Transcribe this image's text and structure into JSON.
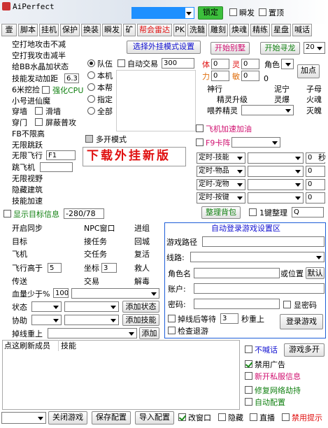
{
  "app": {
    "title": "AiPerfect"
  },
  "header": {
    "dropdown_value": "",
    "lock_button": "锁定",
    "minimize_label": "瞬发",
    "topmost_label": "置顶"
  },
  "tabs": [
    "壹",
    "脚本",
    "挂机",
    "保护",
    "换装",
    "瞬发",
    "矿",
    "帮会雷达",
    "PK",
    "洗髓",
    "雕刻",
    "焕魂",
    "精练",
    "星盘",
    "喊话"
  ],
  "left_features": {
    "items": [
      "空打地攻击不减",
      "空打我攻击减半",
      "给BB水晶加状态",
      "技能发动加距",
      "6米挖捡",
      "小号进仙魔",
      "穿墙",
      "穿门",
      "FB不限高",
      "无限跳跃",
      "无限飞行",
      "跳飞机",
      "无限视野",
      "隐藏建筑",
      "技能加速"
    ],
    "skill_dist_value": "6.3",
    "enhance_cpu": "强化CPU",
    "slide_wall": "滑墙",
    "block_normal_attack": "屏蔽普攻",
    "fly_value": "F1",
    "jump_value": "",
    "show_target_info": "显示目标信息",
    "target_info_value": "-280/78"
  },
  "group_options": {
    "radios": [
      "队伍",
      "本机",
      "本帮",
      "指定",
      "全部"
    ],
    "auto_trade": "自动交易",
    "auto_trade_value": "300",
    "multi_open": "多开模式"
  },
  "top_buttons": {
    "select_mode": "选择外挂模式设置",
    "start_villa": "开始别墅",
    "start_pathfind": "开始寻龙",
    "level_value": "20"
  },
  "attributes": {
    "body_label": "体",
    "body_value": "0",
    "spirit_label": "灵",
    "spirit_value": "0",
    "power_label": "力",
    "power_value": "0",
    "agility_label": "敏",
    "agility_value": "0",
    "role_label": "角色",
    "add_point": "加点",
    "sects": [
      "神行",
      "泥宁",
      "子母",
      "精灵升级",
      "灵爆",
      "火魂",
      "喂养精灵",
      "灭魄"
    ]
  },
  "download_banner": "下载外挂新版",
  "fly_speed": "飞机加速加油",
  "f9_card": "F9卡阵",
  "timers": [
    {
      "label": "定时-技能",
      "value": "0",
      "unit": "秒"
    },
    {
      "label": "定时-物品",
      "value": "0",
      "unit": ""
    },
    {
      "label": "定时-宠物",
      "value": "0",
      "unit": ""
    },
    {
      "label": "定时-按键",
      "value": "0",
      "unit": ""
    }
  ],
  "organize_bag": "整理背包",
  "one_key_organize": "1键整理",
  "organize_key": "Q",
  "middle_left": {
    "start_sync": "开启同步",
    "npc_window": "NPC窗口",
    "advance": "进组",
    "target": "目标",
    "receive_task": "接任务",
    "return_city": "回城",
    "airplane": "飞机",
    "submit_task": "交任务",
    "revive": "复活",
    "fly_higher": "飞行高于",
    "fly_higher_value": "5",
    "coord": "坐标",
    "coord_value": "3",
    "save_person": "救人",
    "teleport": "传送",
    "trade": "交易",
    "detox": "解毒",
    "hp_less": "血量少于%",
    "hp_value": "100",
    "status": "状态",
    "add_status": "添加状态",
    "assist": "协助",
    "add_skill": "添加技能",
    "disconnect": "掉线重上",
    "add": "添加",
    "list_col1": "点这刷新成员",
    "list_col2": "技能"
  },
  "auto_login": {
    "title": "自动登录游戏设置区",
    "game_path": "游戏路径",
    "route": "线路:",
    "role_name": "角色名",
    "or_position": "或位置",
    "default": "默认",
    "account": "账户:",
    "password": "密码:",
    "show_password": "显密码",
    "wait_after_disconnect": "掉线后等待",
    "wait_value": "3",
    "wait_unit": "秒重上",
    "check_exit": "检查退游",
    "login_game": "登录游戏"
  },
  "bottom_right": {
    "no_shout": "不喊话",
    "game_multi": "游戏多开",
    "ban_ads": "禁用广告",
    "new_private": "新开私服信息",
    "fix_network": "修复网络劫持",
    "auto_config": "自动配置"
  },
  "footer": {
    "close_game": "关闭游戏",
    "save_config": "保存配置",
    "import_config": "导入配置",
    "change_window": "改窗口",
    "hide": "隐藏",
    "live": "直播",
    "disable_prompt": "禁用提示"
  },
  "colors": {
    "accent_green": "#2e9e2e",
    "red": "#e01010",
    "blue": "#1010d0"
  }
}
